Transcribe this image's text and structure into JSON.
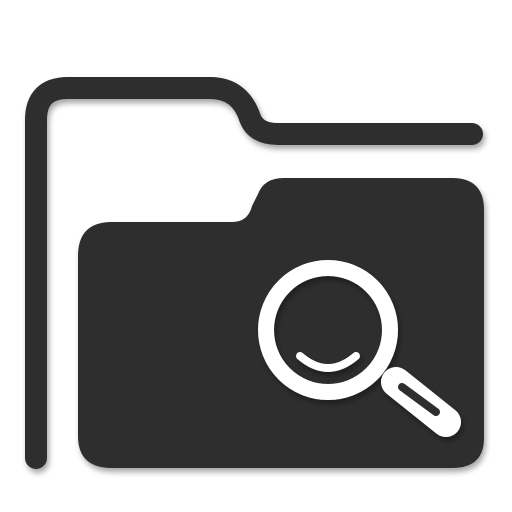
{
  "icon": {
    "name": "folder-search-icon",
    "colors": {
      "background": "#ffffff",
      "folder": "#2e2e2e",
      "magnifier": "#ffffff",
      "shadow": "#000000"
    }
  }
}
